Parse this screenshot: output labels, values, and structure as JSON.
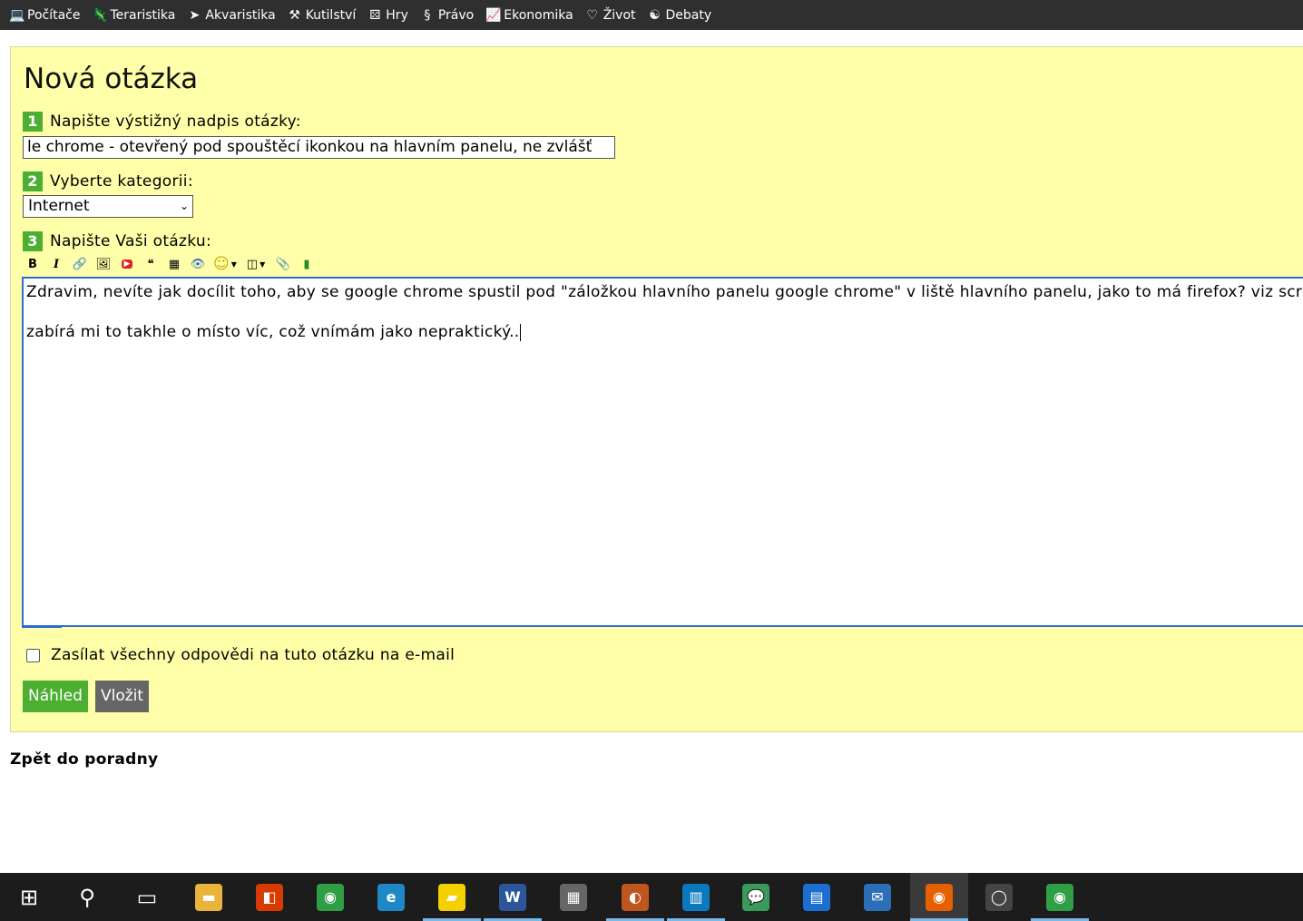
{
  "nav": {
    "items": [
      {
        "label": "Počítače",
        "icon": "laptop-icon",
        "glyph": "💻"
      },
      {
        "label": "Teraristika",
        "icon": "lizard-icon",
        "glyph": "🦎"
      },
      {
        "label": "Akvaristika",
        "icon": "fish-icon",
        "glyph": "➤"
      },
      {
        "label": "Kutilství",
        "icon": "tools-icon",
        "glyph": "⚒"
      },
      {
        "label": "Hry",
        "icon": "dice-icon",
        "glyph": "⚄"
      },
      {
        "label": "Právo",
        "icon": "paragraph-icon",
        "glyph": "§"
      },
      {
        "label": "Ekonomika",
        "icon": "chart-icon",
        "glyph": "📈"
      },
      {
        "label": "Život",
        "icon": "heart-icon",
        "glyph": "♡"
      },
      {
        "label": "Debaty",
        "icon": "speech-icon",
        "glyph": "☯"
      }
    ]
  },
  "form": {
    "title": "Nová otázka",
    "step1": {
      "num": "1",
      "label": "Napište výstižný nadpis otázky:",
      "value": "le chrome - otevřený pod spouštěcí ikonkou na hlavním panelu, ne zvlášť"
    },
    "step2": {
      "num": "2",
      "label": "Vyberte kategorii:",
      "selected": "Internet"
    },
    "step3": {
      "num": "3",
      "label": "Napište Vaši otázku:"
    },
    "toolbar": [
      {
        "name": "bold-icon",
        "glyph": "B"
      },
      {
        "name": "italic-icon",
        "glyph": "I"
      },
      {
        "name": "link-icon",
        "glyph": "🔗"
      },
      {
        "name": "image-icon",
        "glyph": "🖼"
      },
      {
        "name": "youtube-icon",
        "glyph": "▶"
      },
      {
        "name": "quote-icon",
        "glyph": "❝"
      },
      {
        "name": "code-icon",
        "glyph": "▦"
      },
      {
        "name": "spoiler-eye-icon",
        "glyph": "👁"
      },
      {
        "name": "smiley-icon",
        "glyph": "☺",
        "dropdown": true
      },
      {
        "name": "box-icon",
        "glyph": "◫",
        "dropdown": true
      },
      {
        "name": "attachment-icon",
        "glyph": "📎"
      },
      {
        "name": "poll-chart-icon",
        "glyph": "▮"
      }
    ],
    "body_lines": [
      "Zdravim, nevíte jak docílit toho, aby se google chrome spustil pod \"záložkou hlavního panelu google chrome\" v liště hlavního panelu, jako to má firefox? viz screen",
      "zabírá mi to takhle o místo víc, což vnímám jako nepraktický.."
    ],
    "email_checkbox_label": "Zasílat všechny odpovědi na tuto otázku na e-mail",
    "preview_label": "Náhled",
    "submit_label": "Vložit",
    "back_link": "Zpět do poradny"
  },
  "taskbar": {
    "items": [
      {
        "name": "start-icon",
        "glyph": "⊞",
        "color": "transparent"
      },
      {
        "name": "search-icon",
        "glyph": "⚲",
        "color": "transparent"
      },
      {
        "name": "task-view-icon",
        "glyph": "▭",
        "color": "transparent"
      },
      {
        "name": "file-explorer-icon",
        "glyph": "▬",
        "color": "#e8b53a",
        "underline": false
      },
      {
        "name": "office-icon",
        "glyph": "◧",
        "color": "#d83b01"
      },
      {
        "name": "chrome-icon",
        "glyph": "◉",
        "color": "#2f9e44"
      },
      {
        "name": "edge-icon",
        "glyph": "e",
        "color": "#1e88c7"
      },
      {
        "name": "sticky-notes-icon",
        "glyph": "▰",
        "color": "#f5d000",
        "underline": true
      },
      {
        "name": "word-icon",
        "glyph": "W",
        "color": "#2b579a",
        "underline": true
      },
      {
        "name": "calculator-icon",
        "glyph": "▦",
        "color": "#666"
      },
      {
        "name": "thunderbird-icon",
        "glyph": "◐",
        "color": "#c0561e",
        "underline": true
      },
      {
        "name": "trello-icon",
        "glyph": "▥",
        "color": "#0a79bf",
        "underline": true
      },
      {
        "name": "chat-bubble-icon",
        "glyph": "💬",
        "color": "#3a9a5b"
      },
      {
        "name": "messages-icon",
        "glyph": "▤",
        "color": "#1c6fd1"
      },
      {
        "name": "mail-icon",
        "glyph": "✉",
        "color": "#2d6fb7"
      },
      {
        "name": "firefox-icon",
        "glyph": "◉",
        "color": "#e66000",
        "active": true,
        "underline": true
      },
      {
        "name": "color-ring-icon",
        "glyph": "◯",
        "color": "#444"
      },
      {
        "name": "chrome-icon-2",
        "glyph": "◉",
        "color": "#2f9e44",
        "underline": true
      }
    ]
  }
}
